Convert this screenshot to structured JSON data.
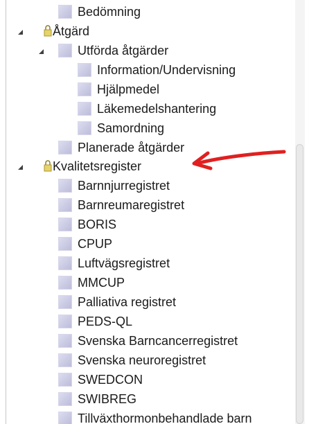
{
  "tree": {
    "nodes": [
      {
        "id": "bedomning",
        "label": "Bedömning",
        "level": 1,
        "icon": "node-icon",
        "toggle": "none"
      },
      {
        "id": "atgard",
        "label": "Åtgärd",
        "level": 0,
        "icon": "lock-icon",
        "toggle": "expanded"
      },
      {
        "id": "utforda",
        "label": "Utförda åtgärder",
        "level": 1,
        "icon": "node-icon",
        "toggle": "expanded"
      },
      {
        "id": "information",
        "label": "Information/Undervisning",
        "level": 2,
        "icon": "node-icon",
        "toggle": "none"
      },
      {
        "id": "hjalpmedel",
        "label": "Hjälpmedel",
        "level": 2,
        "icon": "node-icon",
        "toggle": "none"
      },
      {
        "id": "lakemedel",
        "label": "Läkemedelshantering",
        "level": 2,
        "icon": "node-icon",
        "toggle": "none"
      },
      {
        "id": "samordning",
        "label": "Samordning",
        "level": 2,
        "icon": "node-icon",
        "toggle": "none"
      },
      {
        "id": "planerade",
        "label": "Planerade åtgärder",
        "level": 1,
        "icon": "node-icon",
        "toggle": "none"
      },
      {
        "id": "kvalitet",
        "label": "Kvalitetsregister",
        "level": 0,
        "icon": "lock-icon",
        "toggle": "expanded"
      },
      {
        "id": "barnnjur",
        "label": "Barnnjurregistret",
        "level": 1,
        "icon": "node-icon",
        "toggle": "none"
      },
      {
        "id": "barnreuma",
        "label": "Barnreumaregistret",
        "level": 1,
        "icon": "node-icon",
        "toggle": "none"
      },
      {
        "id": "boris",
        "label": "BORIS",
        "level": 1,
        "icon": "node-icon",
        "toggle": "none"
      },
      {
        "id": "cpup",
        "label": "CPUP",
        "level": 1,
        "icon": "node-icon",
        "toggle": "none"
      },
      {
        "id": "luftvags",
        "label": "Luftvägsregistret",
        "level": 1,
        "icon": "node-icon",
        "toggle": "none"
      },
      {
        "id": "mmcup",
        "label": "MMCUP",
        "level": 1,
        "icon": "node-icon",
        "toggle": "none"
      },
      {
        "id": "palliativa",
        "label": "Palliativa registret",
        "level": 1,
        "icon": "node-icon",
        "toggle": "none"
      },
      {
        "id": "pedsql",
        "label": "PEDS-QL",
        "level": 1,
        "icon": "node-icon",
        "toggle": "none"
      },
      {
        "id": "barncancer",
        "label": "Svenska Barncancerregistret",
        "level": 1,
        "icon": "node-icon",
        "toggle": "none"
      },
      {
        "id": "neuro",
        "label": "Svenska neuroregistret",
        "level": 1,
        "icon": "node-icon",
        "toggle": "none"
      },
      {
        "id": "swedcon",
        "label": "SWEDCON",
        "level": 1,
        "icon": "node-icon",
        "toggle": "none"
      },
      {
        "id": "swibreg",
        "label": "SWIBREG",
        "level": 1,
        "icon": "node-icon",
        "toggle": "none"
      },
      {
        "id": "tillvaxt",
        "label": "Tillväxthormonbehandlade barn",
        "level": 1,
        "icon": "node-icon",
        "toggle": "none"
      }
    ]
  },
  "annotation": {
    "arrow_icon": "red-arrow-icon",
    "arrow_color": "#e02020",
    "points_to": "kvalitet"
  },
  "colors": {
    "node_icon": "#c9c9e3",
    "lock_icon": "#c9b64a",
    "text": "#1a1a1a"
  }
}
